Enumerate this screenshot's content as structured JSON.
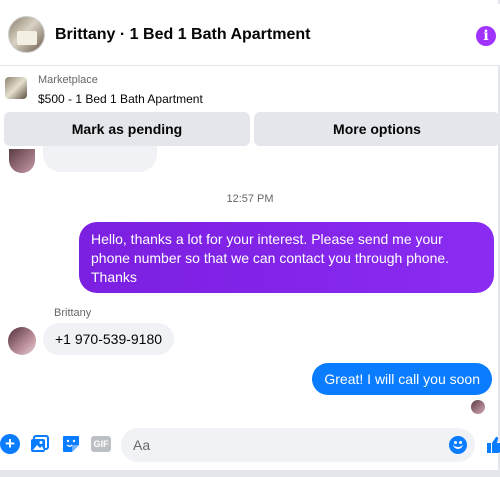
{
  "header": {
    "title": "Brittany · 1 Bed 1 Bath Apartment",
    "info_icon": "info-icon",
    "info_glyph": "i"
  },
  "marketplace": {
    "label": "Marketplace",
    "listing": "$500 - 1 Bed 1 Bath Apartment"
  },
  "actions": {
    "pending_label": "Mark as pending",
    "more_label": "More options"
  },
  "conversation": {
    "timestamp": "12:57 PM",
    "messages": [
      {
        "from": "me",
        "text": "Hello, thanks a lot for your interest. Please send me your phone number so that we can contact you through phone. Thanks"
      },
      {
        "from": "Brittany",
        "sender_label": "Brittany",
        "text": "+1 970-539-9180"
      },
      {
        "from": "me",
        "text": "Great! I will call you soon"
      }
    ]
  },
  "composer": {
    "plus_glyph": "+",
    "gif_label": "GIF",
    "placeholder": "Aa",
    "value": "",
    "icons": [
      "plus-icon",
      "photo-icon",
      "sticker-icon",
      "gif-icon",
      "emoji-icon",
      "like-icon"
    ]
  },
  "colors": {
    "accent": "#0a7cff",
    "outgoing_gradient_start": "#7b1fe0",
    "outgoing_gradient_end": "#8a2bf2",
    "info": "#a033ff",
    "bubble_gray": "#f0f2f5"
  }
}
